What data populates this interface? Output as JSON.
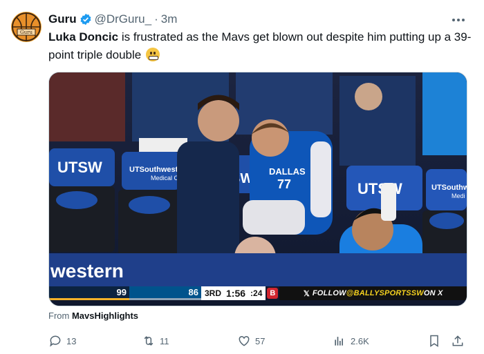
{
  "author": {
    "name": "Guru",
    "handle": "@DrGuru_",
    "separator": "·",
    "time": "3m",
    "avatar_text": "Guru"
  },
  "tweet": {
    "bold_name": "Luka Doncic",
    "text": " is frustrated as the Mavs get blown out despite him putting up a 39-point triple double"
  },
  "media": {
    "seat_texts": [
      "UTSW",
      "UTSouthwest",
      "Medical C",
      "SW",
      "UTSW",
      "UTSouthw",
      "Medi"
    ],
    "jersey_text": "DALLAS",
    "jersey_number": "77",
    "floor_text": "western",
    "scoreboard": {
      "home_score": "99",
      "away_score": "86",
      "period": "3RD",
      "clock": "1:56",
      "shot_clock": ":24",
      "network_logo": "B",
      "follow_prefix": "FOLLOW ",
      "follow_handle": "@BALLYSPORTSSW",
      "follow_suffix": " ON X"
    }
  },
  "source": {
    "prefix": "From ",
    "name": "MavsHighlights"
  },
  "actions": {
    "replies": "13",
    "reposts": "11",
    "likes": "57",
    "views": "2.6K"
  },
  "colors": {
    "verified_blue": "#1d9bf0",
    "mavs_blue": "#00538c",
    "pacers_navy": "#0c2340"
  }
}
